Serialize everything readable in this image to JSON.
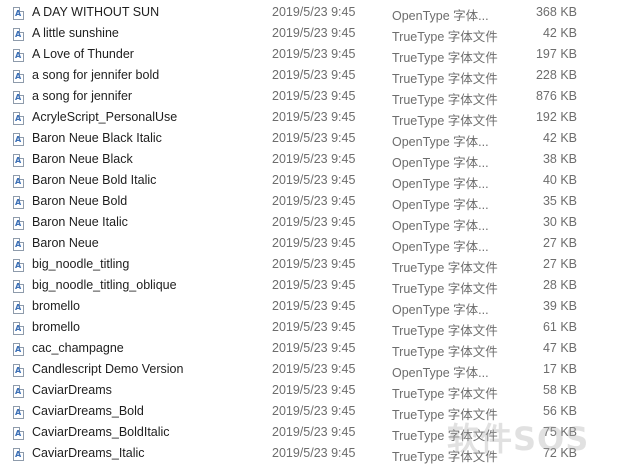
{
  "files": [
    {
      "name": "A DAY WITHOUT SUN",
      "modified": "2019/5/23 9:45",
      "type": "OpenType 字体...",
      "size": "368 KB"
    },
    {
      "name": "A little sunshine",
      "modified": "2019/5/23 9:45",
      "type": "TrueType 字体文件",
      "size": "42 KB"
    },
    {
      "name": "A Love of Thunder",
      "modified": "2019/5/23 9:45",
      "type": "TrueType 字体文件",
      "size": "197 KB"
    },
    {
      "name": "a song for jennifer bold",
      "modified": "2019/5/23 9:45",
      "type": "TrueType 字体文件",
      "size": "228 KB"
    },
    {
      "name": "a song for jennifer",
      "modified": "2019/5/23 9:45",
      "type": "TrueType 字体文件",
      "size": "876 KB"
    },
    {
      "name": "AcryleScript_PersonalUse",
      "modified": "2019/5/23 9:45",
      "type": "TrueType 字体文件",
      "size": "192 KB"
    },
    {
      "name": "Baron Neue Black Italic",
      "modified": "2019/5/23 9:45",
      "type": "OpenType 字体...",
      "size": "42 KB"
    },
    {
      "name": "Baron Neue Black",
      "modified": "2019/5/23 9:45",
      "type": "OpenType 字体...",
      "size": "38 KB"
    },
    {
      "name": "Baron Neue Bold Italic",
      "modified": "2019/5/23 9:45",
      "type": "OpenType 字体...",
      "size": "40 KB"
    },
    {
      "name": "Baron Neue Bold",
      "modified": "2019/5/23 9:45",
      "type": "OpenType 字体...",
      "size": "35 KB"
    },
    {
      "name": "Baron Neue Italic",
      "modified": "2019/5/23 9:45",
      "type": "OpenType 字体...",
      "size": "30 KB"
    },
    {
      "name": "Baron Neue",
      "modified": "2019/5/23 9:45",
      "type": "OpenType 字体...",
      "size": "27 KB"
    },
    {
      "name": "big_noodle_titling",
      "modified": "2019/5/23 9:45",
      "type": "TrueType 字体文件",
      "size": "27 KB"
    },
    {
      "name": "big_noodle_titling_oblique",
      "modified": "2019/5/23 9:45",
      "type": "TrueType 字体文件",
      "size": "28 KB"
    },
    {
      "name": "bromello",
      "modified": "2019/5/23 9:45",
      "type": "OpenType 字体...",
      "size": "39 KB"
    },
    {
      "name": "bromello",
      "modified": "2019/5/23 9:45",
      "type": "TrueType 字体文件",
      "size": "61 KB"
    },
    {
      "name": "cac_champagne",
      "modified": "2019/5/23 9:45",
      "type": "TrueType 字体文件",
      "size": "47 KB"
    },
    {
      "name": "Candlescript Demo Version",
      "modified": "2019/5/23 9:45",
      "type": "OpenType 字体...",
      "size": "17 KB"
    },
    {
      "name": "CaviarDreams",
      "modified": "2019/5/23 9:45",
      "type": "TrueType 字体文件",
      "size": "58 KB"
    },
    {
      "name": "CaviarDreams_Bold",
      "modified": "2019/5/23 9:45",
      "type": "TrueType 字体文件",
      "size": "56 KB"
    },
    {
      "name": "CaviarDreams_BoldItalic",
      "modified": "2019/5/23 9:45",
      "type": "TrueType 字体文件",
      "size": "75 KB"
    },
    {
      "name": "CaviarDreams_Italic",
      "modified": "2019/5/23 9:45",
      "type": "TrueType 字体文件",
      "size": "72 KB"
    }
  ],
  "icon": "font-file-icon",
  "watermark": "软件SOS"
}
